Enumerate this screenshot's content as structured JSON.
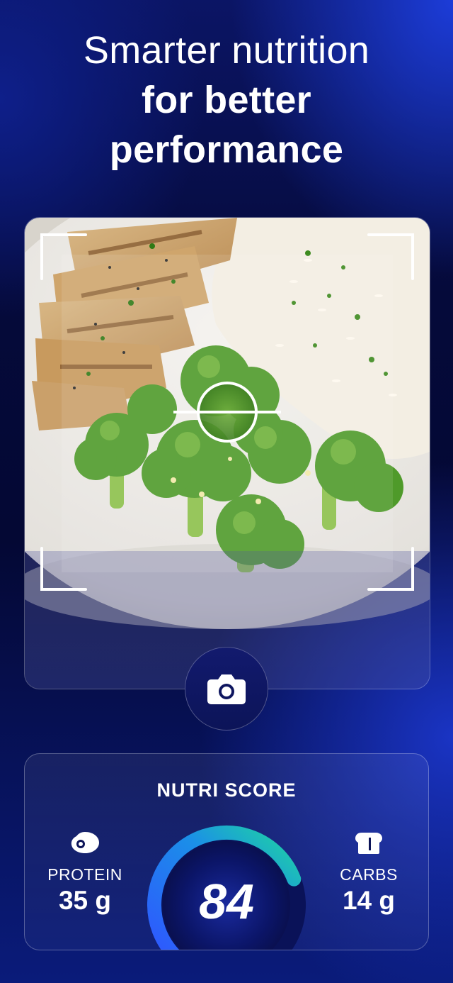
{
  "headline": {
    "line1": "Smarter nutrition",
    "line2": "for better",
    "line3": "performance"
  },
  "scanner": {
    "photo_subject": "grilled chicken, rice and broccoli plate",
    "camera_icon": "camera-icon"
  },
  "nutri": {
    "title": "NUTRI SCORE",
    "score": "84",
    "score_fraction": 0.84,
    "protein": {
      "label": "PROTEIN",
      "value": "35 g",
      "icon": "meat-icon"
    },
    "carbs": {
      "label": "CARBS",
      "value": "14 g",
      "icon": "bread-icon"
    }
  },
  "colors": {
    "gauge_start": "#2f56ff",
    "gauge_mid": "#1b8fe8",
    "gauge_end": "#1ed6a0",
    "broccoli": "#4f9a2a"
  }
}
